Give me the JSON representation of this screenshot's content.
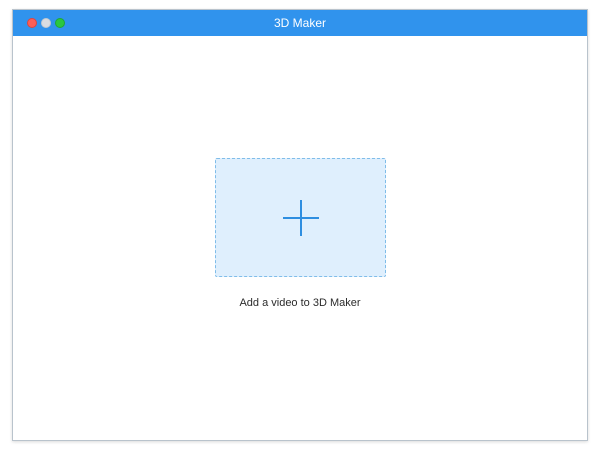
{
  "window": {
    "title": "3D Maker"
  },
  "main": {
    "add_caption": "Add a video to 3D Maker"
  },
  "icons": {
    "add": "plus-icon"
  },
  "colors": {
    "titlebar": "#3093ed",
    "dropzone_fill": "#dfeffd",
    "dropzone_border": "#80bde9",
    "plus": "#2e8ee0"
  }
}
